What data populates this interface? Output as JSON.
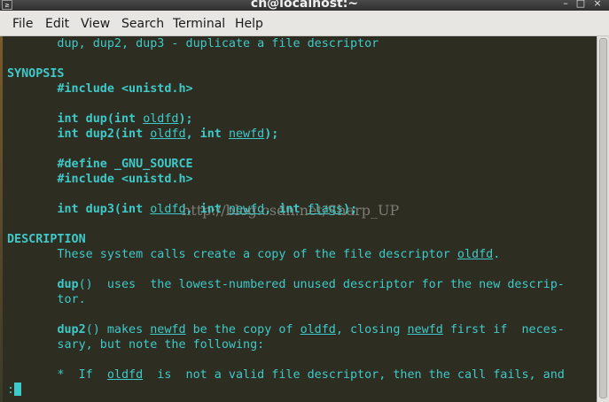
{
  "window": {
    "title": "ch@localhost:~",
    "icon_glyph": "≥",
    "minimize_glyph": "–",
    "maximize_glyph": "□",
    "close_glyph": "×"
  },
  "menubar": {
    "items": [
      "File",
      "Edit",
      "View",
      "Search",
      "Terminal",
      "Help"
    ]
  },
  "terminal": {
    "lines": [
      [
        {
          "t": "       dup, dup2, dup3 - duplicate a file descriptor"
        }
      ],
      [
        {
          "t": ""
        }
      ],
      [
        {
          "t": "SYNOPSIS",
          "s": "b"
        }
      ],
      [
        {
          "t": "       "
        },
        {
          "t": "#include <unistd.h>",
          "s": "b"
        }
      ],
      [
        {
          "t": ""
        }
      ],
      [
        {
          "t": "       "
        },
        {
          "t": "int dup(int ",
          "s": "b"
        },
        {
          "t": "oldfd",
          "s": "u"
        },
        {
          "t": ");",
          "s": "b"
        }
      ],
      [
        {
          "t": "       "
        },
        {
          "t": "int dup2(int ",
          "s": "b"
        },
        {
          "t": "oldfd",
          "s": "u"
        },
        {
          "t": ", int ",
          "s": "b"
        },
        {
          "t": "newfd",
          "s": "u"
        },
        {
          "t": ");",
          "s": "b"
        }
      ],
      [
        {
          "t": ""
        }
      ],
      [
        {
          "t": "       "
        },
        {
          "t": "#define _GNU_SOURCE",
          "s": "b"
        }
      ],
      [
        {
          "t": "       "
        },
        {
          "t": "#include <unistd.h>",
          "s": "b"
        }
      ],
      [
        {
          "t": ""
        }
      ],
      [
        {
          "t": "       "
        },
        {
          "t": "int dup3(int ",
          "s": "b"
        },
        {
          "t": "oldfd",
          "s": "u"
        },
        {
          "t": ", int ",
          "s": "b"
        },
        {
          "t": "newfd",
          "s": "u"
        },
        {
          "t": ", int ",
          "s": "b"
        },
        {
          "t": "flags",
          "s": "u"
        },
        {
          "t": ");",
          "s": "b"
        }
      ],
      [
        {
          "t": ""
        }
      ],
      [
        {
          "t": "DESCRIPTION",
          "s": "b"
        }
      ],
      [
        {
          "t": "       These system calls create a copy of the file descriptor "
        },
        {
          "t": "oldfd",
          "s": "u"
        },
        {
          "t": "."
        }
      ],
      [
        {
          "t": ""
        }
      ],
      [
        {
          "t": "       "
        },
        {
          "t": "dup",
          "s": "b"
        },
        {
          "t": "()  uses  the lowest-numbered unused descriptor for the new descrip-"
        }
      ],
      [
        {
          "t": "       tor."
        }
      ],
      [
        {
          "t": ""
        }
      ],
      [
        {
          "t": "       "
        },
        {
          "t": "dup2",
          "s": "b"
        },
        {
          "t": "() makes "
        },
        {
          "t": "newfd",
          "s": "u"
        },
        {
          "t": " be the copy of "
        },
        {
          "t": "oldfd",
          "s": "u"
        },
        {
          "t": ", closing "
        },
        {
          "t": "newfd",
          "s": "u"
        },
        {
          "t": " first if  neces-"
        }
      ],
      [
        {
          "t": "       sary, but note the following:"
        }
      ],
      [
        {
          "t": ""
        }
      ],
      [
        {
          "t": "       *  If  "
        },
        {
          "t": "oldfd",
          "s": "u"
        },
        {
          "t": "  is  not a valid file descriptor, then the call fails, and"
        }
      ]
    ],
    "prompt": ":",
    "watermark": "http://blog.csdn.net/Sharp_UP"
  },
  "colors": {
    "terminal_bg": "#2d2d21",
    "terminal_fg": "#3fc9c9",
    "menubar_bg": "#e8e6e3"
  }
}
